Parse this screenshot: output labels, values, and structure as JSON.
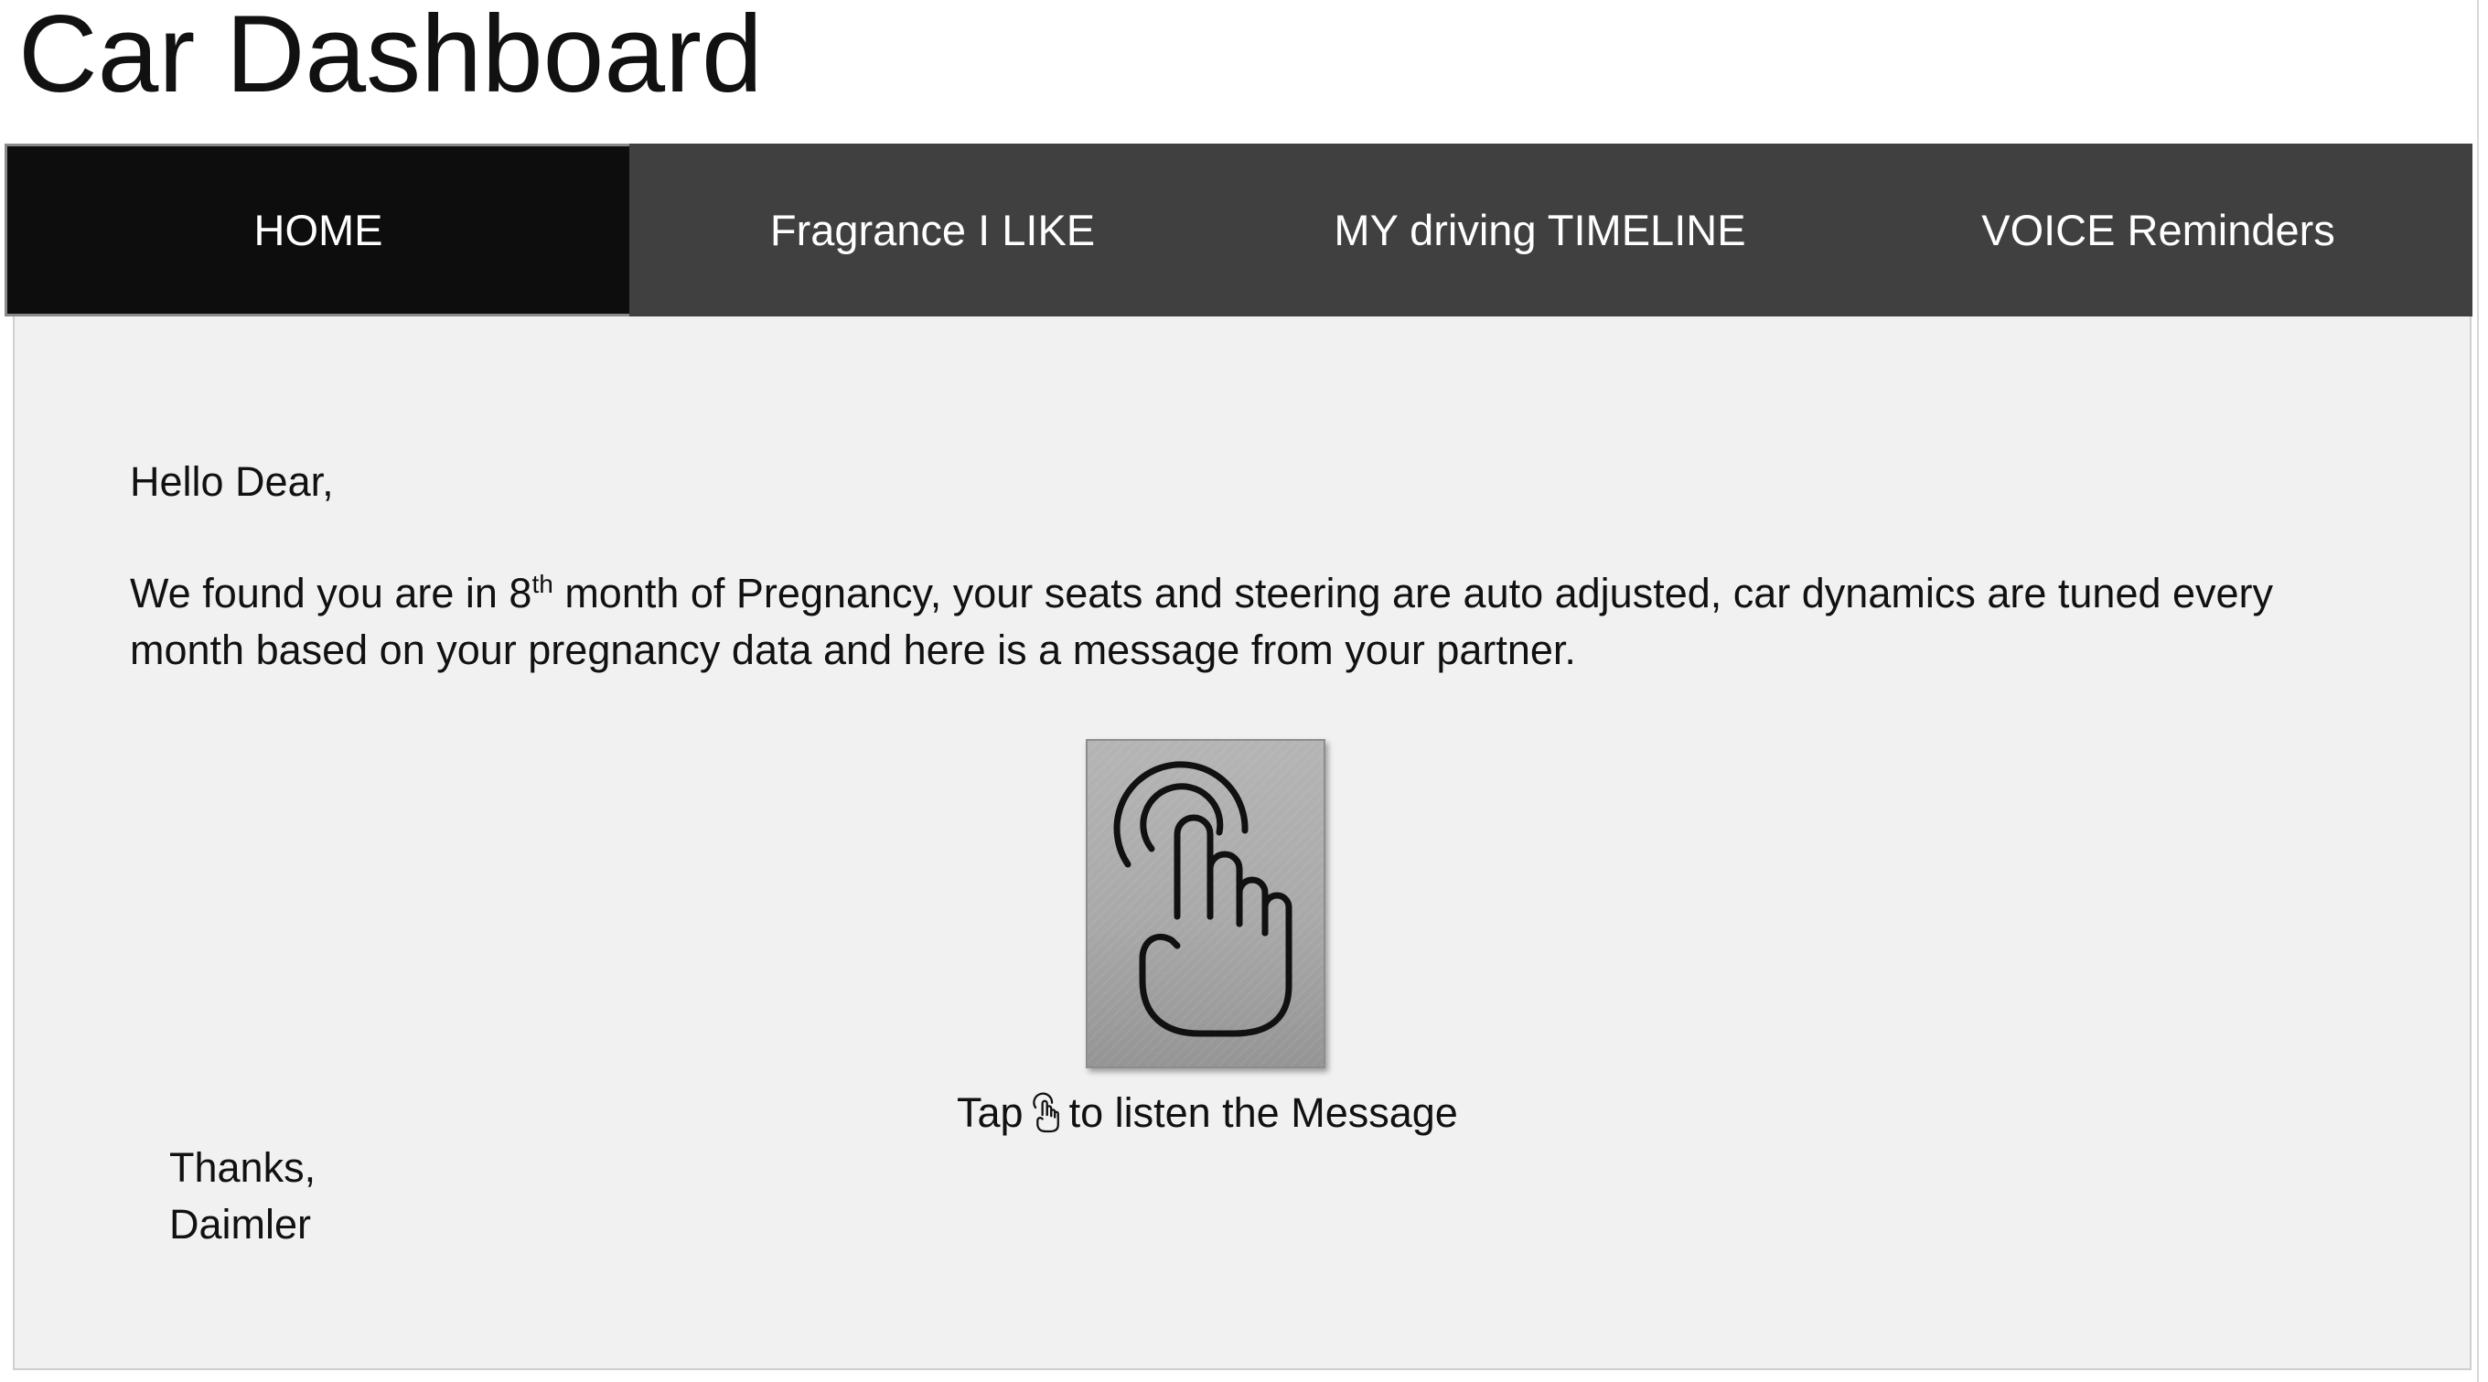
{
  "page": {
    "title": "Car Dashboard"
  },
  "nav": {
    "tabs": [
      {
        "label": "HOME",
        "active": true
      },
      {
        "label": "Fragrance I LIKE",
        "active": false
      },
      {
        "label": "MY driving TIMELINE",
        "active": false
      },
      {
        "label": "VOICE Reminders",
        "active": false
      }
    ]
  },
  "content": {
    "greeting": "Hello Dear,",
    "message_part1": "We found you are in 8",
    "message_sup": "th",
    "message_part2": " month of Pregnancy, your seats and steering are auto adjusted, car dynamics are tuned every month based on your pregnancy data and here is a message from your partner.",
    "tap_button_icon": "touch-gesture-icon",
    "tap_caption_prefix": "Tap",
    "tap_caption_icon": "touch-gesture-icon",
    "tap_caption_suffix": "to listen the Message",
    "closing": "Thanks,",
    "signature": "Daimler"
  },
  "colors": {
    "nav_background": "#404040",
    "nav_active_background": "#0d0d0d",
    "nav_text": "#ffffff",
    "content_background": "#f1f1f1",
    "button_gradient_top": "#b5b5b5",
    "button_gradient_bottom": "#959595"
  }
}
